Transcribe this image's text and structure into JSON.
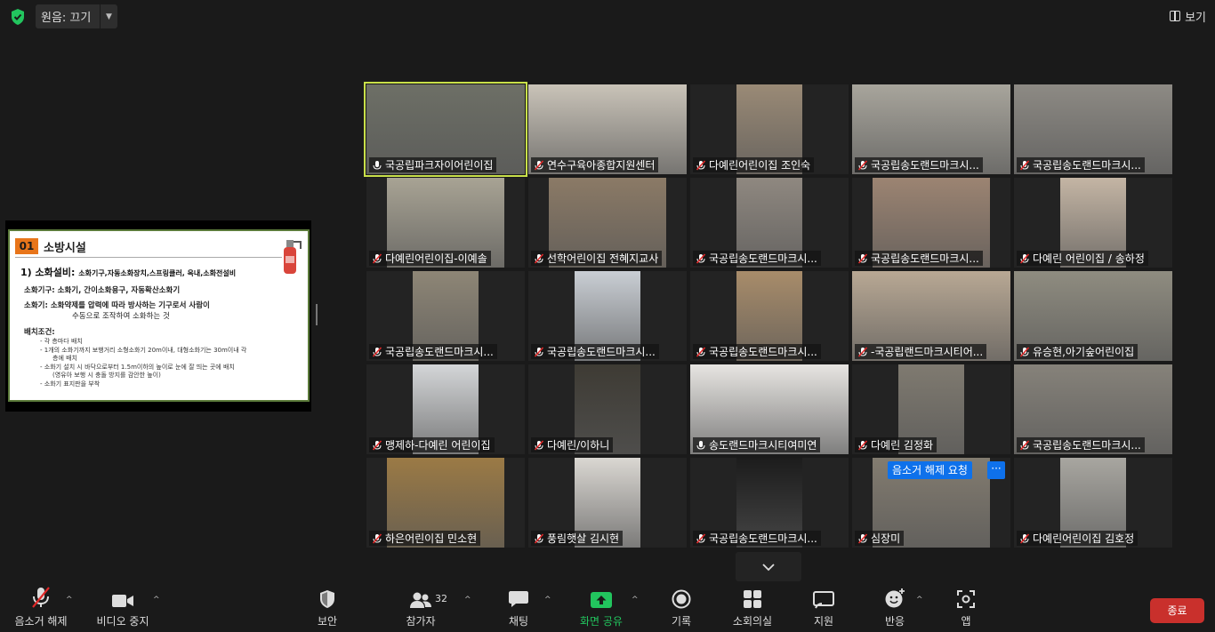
{
  "topbar": {
    "audio_label": "원음: 끄기",
    "view_label": "보기"
  },
  "share": {
    "tag": "01",
    "title": "소방시설",
    "heading": "1) 소화설비:",
    "heading_detail": "소화기구,자동소화장치,스프링클러, 옥내,소화전설비",
    "lines": [
      "소화기구: 소화기, 간이소화용구, 자동확산소화기",
      "소화기: 소화약제를 압력에 따라 방사하는 기구로서 사람이",
      "수동으로 조작하여 소화하는 것",
      "배치조건:",
      "-  각 층마다 배치",
      "-  1개의 소화기까지 보행거리 소형소화기 20m이내, 대형소화기는 30m이내 각",
      "층에 배치",
      "-  소화기 설치 시 바닥으로부터 1.5m이하의 높이로 눈에 잘 띄는 곳에 배치",
      "(영유아 보행 시 충돌 방지를 감안한 높이)",
      "-  소화기 표지판을 부착"
    ]
  },
  "participants": [
    {
      "name": "국공립파크자이어린이집",
      "muted": false,
      "active": true
    },
    {
      "name": "연수구육아종합지원센터",
      "muted": true
    },
    {
      "name": "다예린어린이집 조인숙",
      "muted": true
    },
    {
      "name": "국공립송도랜드마크시...",
      "muted": true
    },
    {
      "name": "국공립송도랜드마크시...",
      "muted": true
    },
    {
      "name": "다예린어린이집-이예솔",
      "muted": true
    },
    {
      "name": "선학어린이집 전혜지교사",
      "muted": true
    },
    {
      "name": "국공립송도랜드마크시...",
      "muted": true
    },
    {
      "name": "국공립송도랜드마크시...",
      "muted": true
    },
    {
      "name": "다예린 어린이집 / 송하정",
      "muted": true
    },
    {
      "name": "국공립송도랜드마크시...",
      "muted": true
    },
    {
      "name": "국공립송도랜드마크시...",
      "muted": true
    },
    {
      "name": "국공립송도랜드마크시...",
      "muted": true
    },
    {
      "name": "-국공립랜드마크시티어...",
      "muted": true
    },
    {
      "name": "유승현,아기숲어린이집",
      "muted": true
    },
    {
      "name": "맹제하-다예린 어린이집",
      "muted": true
    },
    {
      "name": "다예린/이하니",
      "muted": true
    },
    {
      "name": "송도랜드마크시티여미연",
      "muted": false
    },
    {
      "name": "다예린 김정화",
      "muted": true
    },
    {
      "name": "국공립송도랜드마크시...",
      "muted": true
    },
    {
      "name": "하은어린이집 민소현",
      "muted": true
    },
    {
      "name": "풍림햇살 김시현",
      "muted": true
    },
    {
      "name": "국공립송도랜드마크시...",
      "muted": true
    },
    {
      "name": "심장미",
      "muted": true
    },
    {
      "name": "다예린어린이집 김호정",
      "muted": true
    }
  ],
  "unmute_request": "음소거 해제 요청",
  "more_label": "···",
  "toolbar": {
    "unmute": "음소거 해제",
    "video_stop": "비디오 중지",
    "security": "보안",
    "participants": "참가자",
    "participants_count": "32",
    "chat": "채팅",
    "share_screen": "화면 공유",
    "record": "기록",
    "breakout": "소회의실",
    "support": "지원",
    "reactions": "반응",
    "apps": "앱",
    "end": "종료"
  },
  "colors": {
    "background": "#1a1a1a",
    "tile": "#232323",
    "active_border": "#c9e04a",
    "mute_red": "#e02828",
    "share_green": "#22c55e",
    "end_red": "#c9302c",
    "blue": "#0e71eb"
  }
}
